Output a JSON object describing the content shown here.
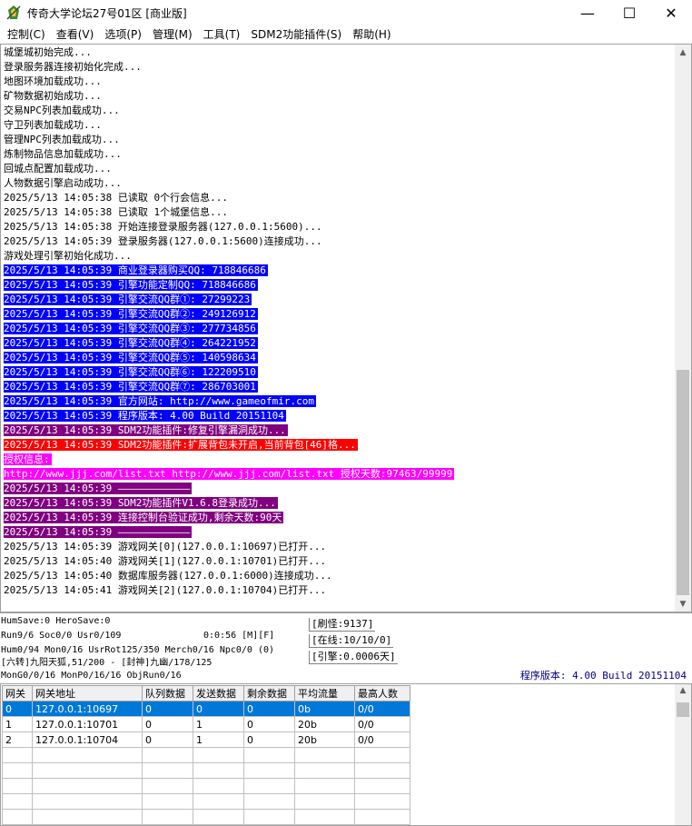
{
  "window": {
    "title": "传奇大学论坛27号01区 [商业版]",
    "minimize": "—",
    "maximize": "☐",
    "close": "✕"
  },
  "menu": [
    {
      "label": "控制(C)"
    },
    {
      "label": "查看(V)"
    },
    {
      "label": "选项(P)"
    },
    {
      "label": "管理(M)"
    },
    {
      "label": "工具(T)"
    },
    {
      "label": "SDM2功能插件(S)"
    },
    {
      "label": "帮助(H)"
    }
  ],
  "colors": {
    "blue": "#0000ff",
    "purple": "#800080",
    "red": "#ff0000",
    "magenta": "#ff00ff",
    "highlight_text": "#ffffff"
  },
  "log": [
    {
      "text": "城堡城初始完成...",
      "style": "plain"
    },
    {
      "text": "登录服务器连接初始化完成...",
      "style": "plain"
    },
    {
      "text": "地图环境加载成功...",
      "style": "plain"
    },
    {
      "text": "矿物数据初始成功...",
      "style": "plain"
    },
    {
      "text": "交易NPC列表加载成功...",
      "style": "plain"
    },
    {
      "text": "守卫列表加载成功...",
      "style": "plain"
    },
    {
      "text": "管理NPC列表加载成功...",
      "style": "plain"
    },
    {
      "text": "炼制物品信息加载成功...",
      "style": "plain"
    },
    {
      "text": "回城点配置加载成功...",
      "style": "plain"
    },
    {
      "text": "人物数据引擎启动成功...",
      "style": "plain"
    },
    {
      "text": "2025/5/13 14:05:38 已读取 0个行会信息...",
      "style": "plain"
    },
    {
      "text": "2025/5/13 14:05:38 已读取 1个城堡信息...",
      "style": "plain"
    },
    {
      "text": "2025/5/13 14:05:38 开始连接登录服务器(127.0.0.1:5600)...",
      "style": "plain"
    },
    {
      "text": "2025/5/13 14:05:39 登录服务器(127.0.0.1:5600)连接成功...",
      "style": "plain"
    },
    {
      "text": "游戏处理引擎初始化成功...",
      "style": "plain"
    },
    {
      "text": "2025/5/13 14:05:39 商业登录器购买QQ: 718846686",
      "style": "blue"
    },
    {
      "text": "2025/5/13 14:05:39 引擎功能定制QQ: 718846686",
      "style": "blue"
    },
    {
      "text": "2025/5/13 14:05:39 引擎交流QQ群①: 27299223",
      "style": "blue"
    },
    {
      "text": "2025/5/13 14:05:39 引擎交流QQ群②: 249126912",
      "style": "blue"
    },
    {
      "text": "2025/5/13 14:05:39 引擎交流QQ群③: 277734856",
      "style": "blue"
    },
    {
      "text": "2025/5/13 14:05:39 引擎交流QQ群④: 264221952",
      "style": "blue"
    },
    {
      "text": "2025/5/13 14:05:39 引擎交流QQ群⑤: 140598634",
      "style": "blue"
    },
    {
      "text": "2025/5/13 14:05:39 引擎交流QQ群⑥: 122209510",
      "style": "blue"
    },
    {
      "text": "2025/5/13 14:05:39 引擎交流QQ群⑦: 286703001",
      "style": "blue"
    },
    {
      "text": "2025/5/13 14:05:39 官方网站: http://www.gameofmir.com",
      "style": "blue"
    },
    {
      "text": "2025/5/13 14:05:39 程序版本: 4.00 Build 20151104",
      "style": "blue"
    },
    {
      "text": "2025/5/13 14:05:39 SDM2功能插件:修复引擎漏洞成功...",
      "style": "purple"
    },
    {
      "text": "2025/5/13 14:05:39 SDM2功能插件:扩展背包未开启,当前背包[46]格...",
      "style": "red"
    },
    {
      "text": "授权信息:",
      "style": "magenta"
    },
    {
      "text": "http://www.jjj.com/list.txt http://www.jjj.com/list.txt 授权天数:97463/99999",
      "style": "magenta"
    },
    {
      "text": "2025/5/13 14:05:39 ————————————",
      "style": "purple"
    },
    {
      "text": "2025/5/13 14:05:39 SDM2功能插件V1.6.8登录成功...",
      "style": "purple"
    },
    {
      "text": "2025/5/13 14:05:39 连接控制台验证成功,剩余天数:90天",
      "style": "purple"
    },
    {
      "text": "2025/5/13 14:05:39 ————————————",
      "style": "purple"
    },
    {
      "text": "2025/5/13 14:05:39 游戏网关[0](127.0.0.1:10697)已打开...",
      "style": "plain"
    },
    {
      "text": "2025/5/13 14:05:40 游戏网关[1](127.0.0.1:10701)已打开...",
      "style": "plain"
    },
    {
      "text": "2025/5/13 14:05:40 数据库服务器(127.0.0.1:6000)连接成功...",
      "style": "plain"
    },
    {
      "text": "2025/5/13 14:05:41 游戏网关[2](127.0.0.1:10704)已打开...",
      "style": "plain"
    }
  ],
  "status": {
    "line1": "HumSave:0 HeroSave:0",
    "line2": "Run9/6 Soc0/0 Usr0/109",
    "line2_time": "0:0:56 [M][F]",
    "line3": "Hum0/94 Mon0/16 UsrRot125/350 Merch0/16 Npc0/0 (0)",
    "line4": "[六转]九阳天狐,51/200 - [封神]九幽/178/125",
    "line5": "MonG0/0/16 MonP0/16/16 ObjRun0/16",
    "monster": "[刷怪:9137]",
    "online": "[在线:10/10/0]",
    "engine": "[引擎:0.0006天]",
    "version": "程序版本: 4.00 Build 20151104"
  },
  "gates": {
    "headers": [
      "网关",
      "网关地址",
      "队列数据",
      "发送数据",
      "剩余数据",
      "平均流量",
      "最高人数"
    ],
    "rows": [
      [
        "0",
        "127.0.0.1:10697",
        "0",
        "0",
        "0",
        "0b",
        "0/0"
      ],
      [
        "1",
        "127.0.0.1:10701",
        "0",
        "1",
        "0",
        "20b",
        "0/0"
      ],
      [
        "2",
        "127.0.0.1:10704",
        "0",
        "1",
        "0",
        "20b",
        "0/0"
      ]
    ],
    "selected_row": 0,
    "empty_rows": 5
  }
}
